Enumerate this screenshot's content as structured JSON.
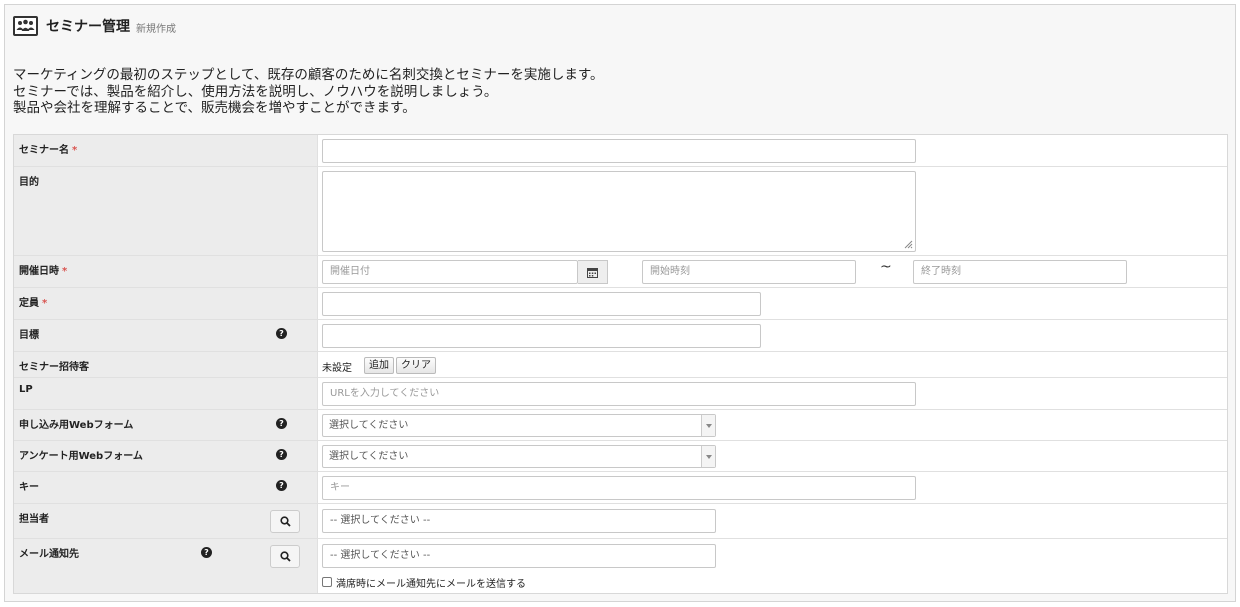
{
  "header": {
    "icon": "seminar-people-icon",
    "title": "セミナー管理",
    "subtitle": "新規作成"
  },
  "description": [
    "マーケティングの最初のステップとして、既存の顧客のために名刺交換とセミナーを実施します。",
    "セミナーでは、製品を紹介し、使用方法を説明し、ノウハウを説明しましょう。",
    "製品や会社を理解することで、販売機会を増やすことができます。"
  ],
  "required_mark": "*",
  "fields": {
    "seminar_name": {
      "label": "セミナー名",
      "value": ""
    },
    "purpose": {
      "label": "目的",
      "value": ""
    },
    "datetime": {
      "label": "開催日時",
      "date_placeholder": "開催日付",
      "start_placeholder": "開始時刻",
      "separator": "~",
      "end_placeholder": "終了時刻"
    },
    "capacity": {
      "label": "定員",
      "value": ""
    },
    "goal": {
      "label": "目標",
      "value": ""
    },
    "invitees": {
      "label": "セミナー招待客",
      "status": "未設定",
      "add_label": "追加",
      "clear_label": "クリア"
    },
    "lp": {
      "label": "LP",
      "placeholder": "URLを入力してください"
    },
    "apply_form": {
      "label": "申し込み用Webフォーム",
      "selected": "選択してください"
    },
    "survey_form": {
      "label": "アンケート用Webフォーム",
      "selected": "選択してください"
    },
    "key": {
      "label": "キー",
      "placeholder": "キー"
    },
    "owner": {
      "label": "担当者",
      "placeholder": "-- 選択してください --"
    },
    "mail_notify": {
      "label": "メール通知先",
      "placeholder": "-- 選択してください --",
      "checkbox_label": "満席時にメール通知先にメールを送信する"
    }
  },
  "help_glyph": "?"
}
